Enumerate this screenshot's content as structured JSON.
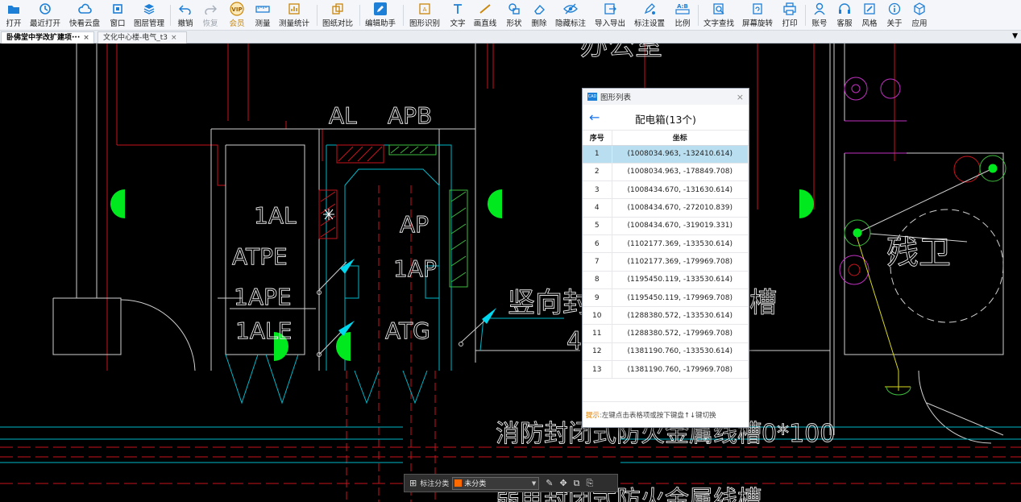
{
  "toolbar": {
    "items": [
      {
        "label": "打开",
        "icon": "folder-open-icon"
      },
      {
        "label": "最近打开",
        "icon": "history-icon"
      },
      {
        "label": "快看云盘",
        "icon": "cloud-icon"
      },
      {
        "label": "窗口",
        "icon": "window-icon"
      },
      {
        "label": "图层管理",
        "icon": "layers-icon"
      },
      {
        "label": "撤销",
        "icon": "undo-icon"
      },
      {
        "label": "恢复",
        "icon": "redo-icon"
      },
      {
        "label": "会员",
        "icon": "vip-icon",
        "badge": "VIP"
      },
      {
        "label": "测量",
        "icon": "ruler-icon"
      },
      {
        "label": "测量统计",
        "icon": "measure-stats-icon"
      },
      {
        "label": "图纸对比",
        "icon": "compare-icon"
      },
      {
        "label": "编辑助手",
        "icon": "edit-assistant-icon"
      },
      {
        "label": "图形识别",
        "icon": "shape-recognize-icon"
      },
      {
        "label": "文字",
        "icon": "text-icon"
      },
      {
        "label": "画直线",
        "icon": "line-icon"
      },
      {
        "label": "形状",
        "icon": "shape-icon"
      },
      {
        "label": "删除",
        "icon": "eraser-icon"
      },
      {
        "label": "隐藏标注",
        "icon": "hide-icon"
      },
      {
        "label": "导入导出",
        "icon": "import-export-icon"
      },
      {
        "label": "标注设置",
        "icon": "annotation-settings-icon"
      },
      {
        "label": "比例",
        "icon": "scale-icon",
        "badge": "A:B"
      },
      {
        "label": "文字查找",
        "icon": "text-search-icon"
      },
      {
        "label": "屏幕旋转",
        "icon": "rotate-screen-icon"
      },
      {
        "label": "打印",
        "icon": "print-icon"
      },
      {
        "label": "账号",
        "icon": "account-icon"
      },
      {
        "label": "客服",
        "icon": "headset-icon"
      },
      {
        "label": "风格",
        "icon": "style-icon"
      },
      {
        "label": "关于",
        "icon": "info-icon"
      },
      {
        "label": "应用",
        "icon": "apps-icon"
      }
    ]
  },
  "tabs": [
    {
      "label": "卧佛堂中学改扩建项···",
      "close": "×"
    },
    {
      "label": "文化中心楼-电气_t3",
      "close": "×"
    }
  ],
  "tab_menu": "▼",
  "drawing": {
    "labels": {
      "office": "办公室",
      "al": "AL",
      "apb": "APB",
      "al1": "1AL",
      "ap": "AP",
      "atpe": "ATPE",
      "ap1": "1AP",
      "ape1": "1APE",
      "ale1": "1ALE",
      "atg": "ATG",
      "shaft": "竖向封闭式防火槽",
      "shaft_partial": "竖向封",
      "shaft_tail": "槽",
      "shaft_4": "4",
      "fire_tray": "消防封闭式防火金属线槽0*100",
      "fire_tray_2": "弱电封闭式防火金属线槽",
      "restroom": "残卫"
    }
  },
  "dialog": {
    "title": "图形列表",
    "close": "×",
    "back": "←",
    "heading": "配电箱(13个)",
    "col_index": "序号",
    "col_coord": "坐标",
    "rows": [
      {
        "i": "1",
        "c": "(1008034.963, -132410.614)"
      },
      {
        "i": "2",
        "c": "(1008034.963, -178849.708)"
      },
      {
        "i": "3",
        "c": "(1008434.670, -131630.614)"
      },
      {
        "i": "4",
        "c": "(1008434.670, -272010.839)"
      },
      {
        "i": "5",
        "c": "(1008434.670, -319019.331)"
      },
      {
        "i": "6",
        "c": "(1102177.369, -133530.614)"
      },
      {
        "i": "7",
        "c": "(1102177.369, -179969.708)"
      },
      {
        "i": "8",
        "c": "(1195450.119, -133530.614)"
      },
      {
        "i": "9",
        "c": "(1195450.119, -179969.708)"
      },
      {
        "i": "10",
        "c": "(1288380.572, -133530.614)"
      },
      {
        "i": "11",
        "c": "(1288380.572, -179969.708)"
      },
      {
        "i": "12",
        "c": "(1381190.760, -133530.614)"
      },
      {
        "i": "13",
        "c": "(1381190.760, -179969.708)"
      }
    ],
    "selected_row": 1,
    "tip_prefix": "提示:",
    "tip_text": "左键点击表格项或按下键盘↑↓键切换"
  },
  "bottombar": {
    "label": "标注分类",
    "category": "未分类",
    "category_color": "#ff6a00"
  }
}
